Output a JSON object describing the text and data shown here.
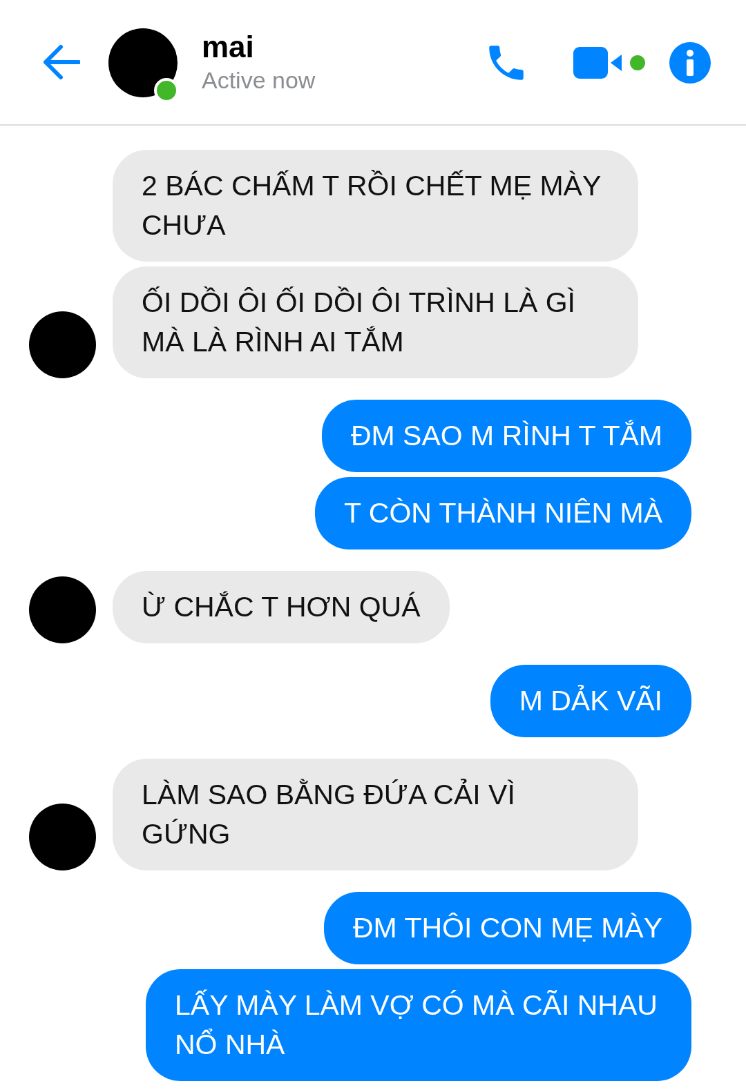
{
  "header": {
    "name": "mai",
    "status": "Active now",
    "active": true
  },
  "messages": [
    {
      "kind": "received",
      "text": "2 BÁC CHẤM T RỒI CHẾT MẸ MÀY CHƯA",
      "avatar": false
    },
    {
      "kind": "received",
      "text": "ỐI DỒI ÔI ỐI DỒI ÔI TRÌNH LÀ GÌ MÀ LÀ RÌNH AI TẮM",
      "avatar": true
    },
    {
      "kind": "sent",
      "text": "ĐM SAO M RÌNH T TẮM"
    },
    {
      "kind": "sent",
      "text": "T CÒN THÀNH NIÊN MÀ"
    },
    {
      "kind": "received",
      "text": "Ừ CHẮC T HƠN QUÁ",
      "avatar": true
    },
    {
      "kind": "sent",
      "text": "M DẢK VÃI"
    },
    {
      "kind": "received",
      "text": "LÀM SAO BẰNG ĐỨA CẢI VÌ GỨNG",
      "avatar": true
    },
    {
      "kind": "sent",
      "text": "ĐM THÔI CON MẸ MÀY"
    },
    {
      "kind": "sent",
      "text": "LẤY MÀY LÀM VỢ CÓ MÀ CÃI NHAU NỔ NHÀ"
    }
  ]
}
